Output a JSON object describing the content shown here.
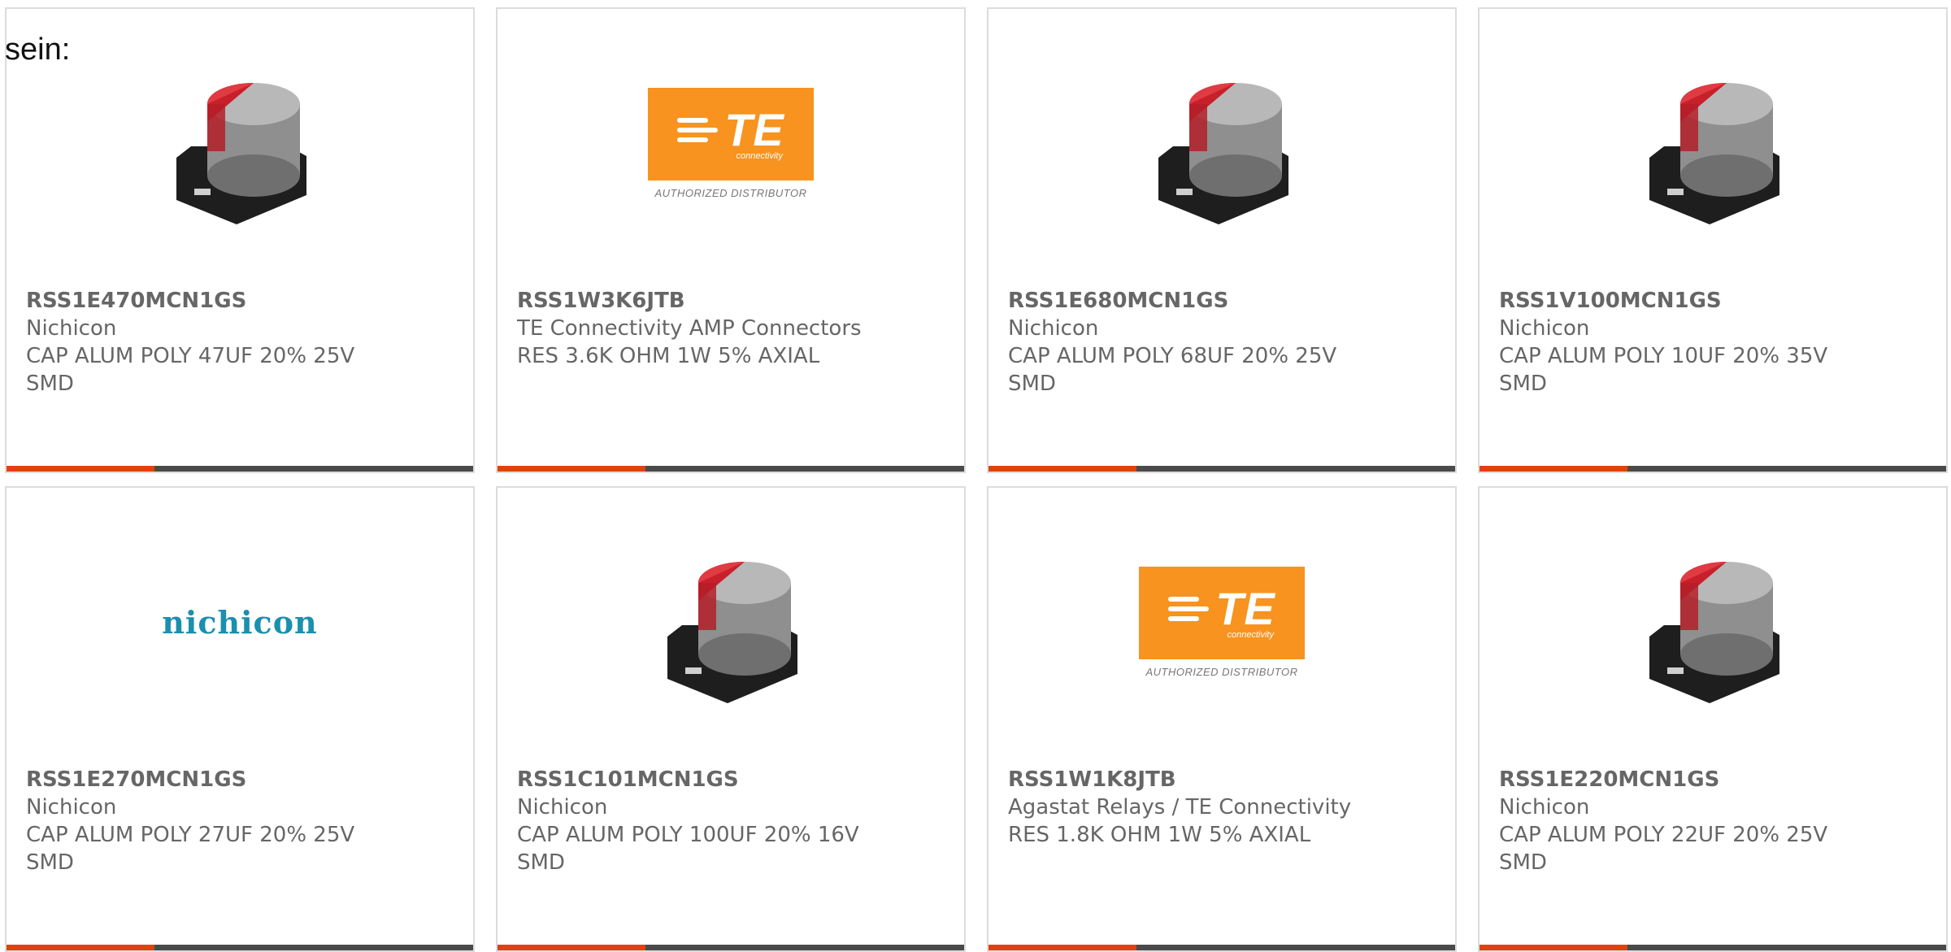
{
  "intro_text": "sein:",
  "accent_color": "#e0420f",
  "bar_color": "#4a4a4a",
  "logos": {
    "te_wordmark": "TE",
    "te_sub": "connectivity",
    "te_authorized": "AUTHORIZED DISTRIBUTOR",
    "nichicon_wordmark": "nichicon"
  },
  "products": [
    {
      "part": "RSS1E470MCN1GS",
      "manufacturer": "Nichicon",
      "description": "CAP ALUM POLY 47UF 20% 25V SMD",
      "image": "capacitor-image"
    },
    {
      "part": "RSS1W3K6JTB",
      "manufacturer": "TE Connectivity AMP Connectors",
      "description": "RES 3.6K OHM 1W 5% AXIAL",
      "image": "te-logo"
    },
    {
      "part": "RSS1E680MCN1GS",
      "manufacturer": "Nichicon",
      "description": "CAP ALUM POLY 68UF 20% 25V SMD",
      "image": "capacitor-image"
    },
    {
      "part": "RSS1V100MCN1GS",
      "manufacturer": "Nichicon",
      "description": "CAP ALUM POLY 10UF 20% 35V SMD",
      "image": "capacitor-image"
    },
    {
      "part": "RSS1E270MCN1GS",
      "manufacturer": "Nichicon",
      "description": "CAP ALUM POLY 27UF 20% 25V SMD",
      "image": "nichicon-logo"
    },
    {
      "part": "RSS1C101MCN1GS",
      "manufacturer": "Nichicon",
      "description": "CAP ALUM POLY 100UF 20% 16V SMD",
      "image": "capacitor-image"
    },
    {
      "part": "RSS1W1K8JTB",
      "manufacturer": "Agastat Relays / TE Connectivity",
      "description": "RES 1.8K OHM 1W 5% AXIAL",
      "image": "te-logo"
    },
    {
      "part": "RSS1E220MCN1GS",
      "manufacturer": "Nichicon",
      "description": "CAP ALUM POLY 22UF 20% 25V SMD",
      "image": "capacitor-image"
    }
  ]
}
